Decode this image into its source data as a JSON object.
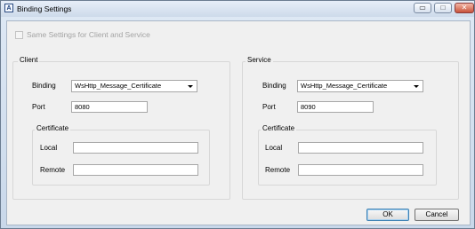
{
  "window": {
    "title": "Binding Settings",
    "icon": "A",
    "controls": {
      "minimize": "▭",
      "maximize": "□",
      "close": "✕"
    }
  },
  "same_settings": {
    "label": "Same Settings for Client and Service",
    "checked": false,
    "enabled": false
  },
  "client": {
    "group_label": "Client",
    "binding_label": "Binding",
    "binding_value": "WsHttp_Message_Certificate",
    "port_label": "Port",
    "port_value": "8080",
    "certificate_label": "Certificate",
    "local_label": "Local",
    "local_value": "",
    "remote_label": "Remote",
    "remote_value": ""
  },
  "service": {
    "group_label": "Service",
    "binding_label": "Binding",
    "binding_value": "WsHttp_Message_Certificate",
    "port_label": "Port",
    "port_value": "8090",
    "certificate_label": "Certificate",
    "local_label": "Local",
    "local_value": "",
    "remote_label": "Remote",
    "remote_value": ""
  },
  "buttons": {
    "ok": "OK",
    "cancel": "Cancel"
  }
}
